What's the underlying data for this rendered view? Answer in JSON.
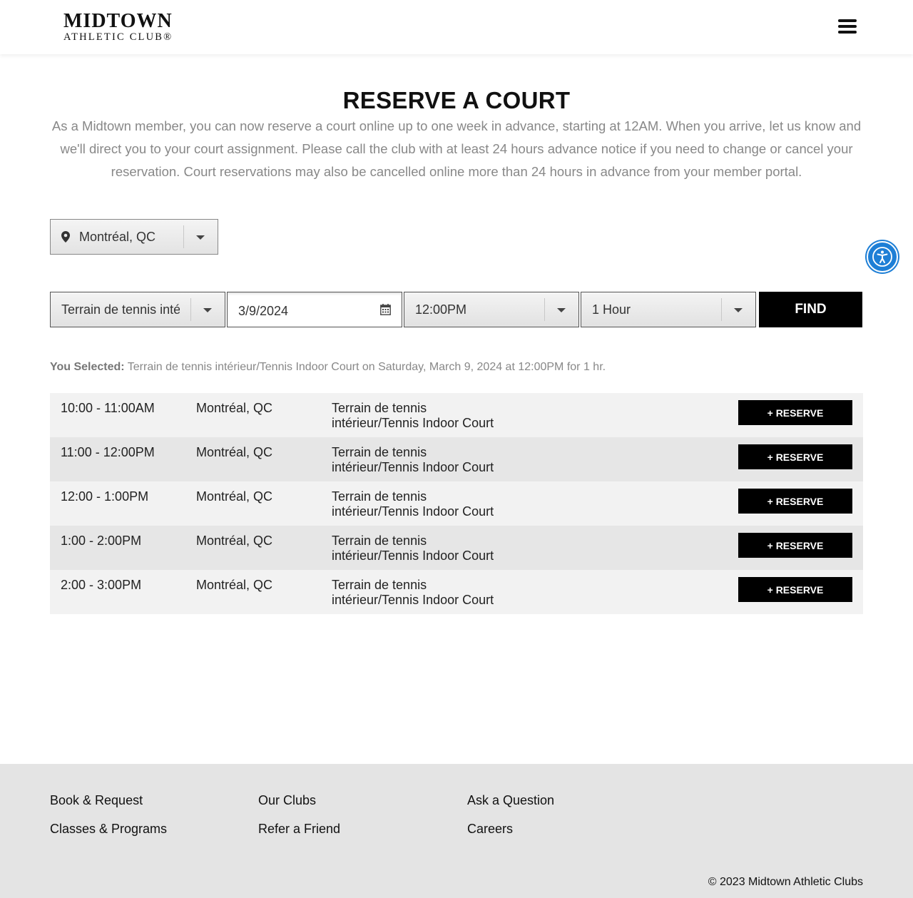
{
  "header": {
    "logo_line1": "MIDTOWN",
    "logo_line2": "ATHLETIC CLUB®",
    "menu_icon": "hamburger-menu-icon"
  },
  "page": {
    "title": "RESERVE A COURT",
    "intro": "As a Midtown member, you can now reserve a court online up to one week in advance, starting at 12AM. When you arrive, let us know and we'll direct you to your court assignment. Please call the club with at least 24 hours advance notice if you need to change or cancel your reservation. Court reservations may also be cancelled online more than 24 hours in advance from your member portal."
  },
  "location": {
    "selected": "Montréal, QC",
    "icon": "map-pin-icon"
  },
  "filters": {
    "court_type": "Terrain de tennis intérieur/Tennis Indoor Court",
    "date": "3/9/2024",
    "time": "12:00PM",
    "duration": "1 Hour",
    "find_label": "FIND"
  },
  "summary": {
    "label": "You Selected:",
    "text": " Terrain de tennis intérieur/Tennis Indoor Court on Saturday, March 9, 2024 at 12:00PM for 1 hr."
  },
  "results": [
    {
      "time": "10:00 - 11:00AM",
      "location": "Montréal, QC",
      "court": "Terrain de tennis intérieur/Tennis Indoor Court",
      "action": "+ RESERVE"
    },
    {
      "time": "11:00 - 12:00PM",
      "location": "Montréal, QC",
      "court": "Terrain de tennis intérieur/Tennis Indoor Court",
      "action": "+ RESERVE"
    },
    {
      "time": "12:00 - 1:00PM",
      "location": "Montréal, QC",
      "court": "Terrain de tennis intérieur/Tennis Indoor Court",
      "action": "+ RESERVE"
    },
    {
      "time": "1:00 - 2:00PM",
      "location": "Montréal, QC",
      "court": "Terrain de tennis intérieur/Tennis Indoor Court",
      "action": "+ RESERVE"
    },
    {
      "time": "2:00 - 3:00PM",
      "location": "Montréal, QC",
      "court": "Terrain de tennis intérieur/Tennis Indoor Court",
      "action": "+ RESERVE"
    }
  ],
  "footer": {
    "links": [
      "Book & Request",
      "Classes & Programs",
      "Our Clubs",
      "Refer a Friend",
      "Ask a Question",
      "Careers"
    ],
    "copyright": "© 2023 Midtown Athletic Clubs"
  },
  "colors": {
    "accent_blue": "#1e7fd6",
    "button_black": "#000000",
    "muted_text": "#888888",
    "footer_bg": "#e4e4e4"
  }
}
